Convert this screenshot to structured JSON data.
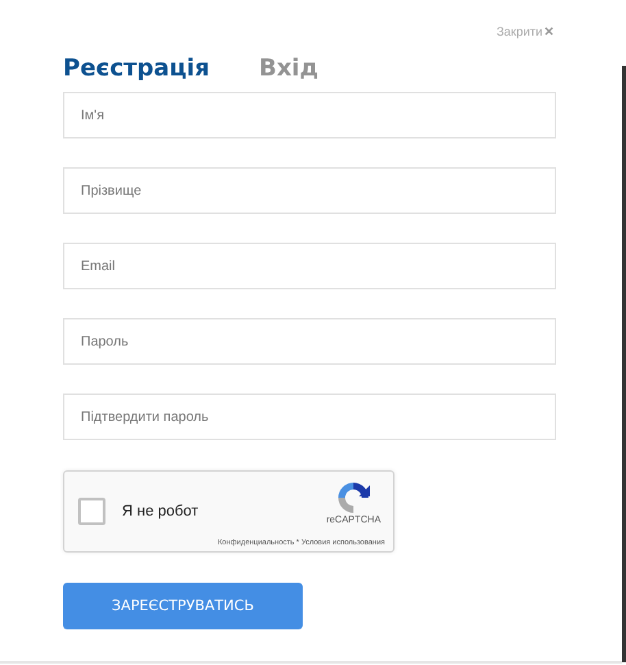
{
  "close": {
    "label": "Закрити",
    "icon": "✕"
  },
  "tabs": [
    {
      "label": "Реєстрація",
      "selected": true
    },
    {
      "label": "Вхід",
      "selected": false
    }
  ],
  "fields": [
    {
      "placeholder": "Ім'я"
    },
    {
      "placeholder": "Прізвище"
    },
    {
      "placeholder": "Email"
    },
    {
      "placeholder": "Пароль"
    },
    {
      "placeholder": "Підтвердити пароль"
    }
  ],
  "captcha": {
    "label": "Я не робот",
    "checked": false,
    "brand": "reCAPTCHA",
    "terms": "Конфиденциальность * Условия использования"
  },
  "submit": "ЗАРЕЄСТРУВАТИСЬ"
}
